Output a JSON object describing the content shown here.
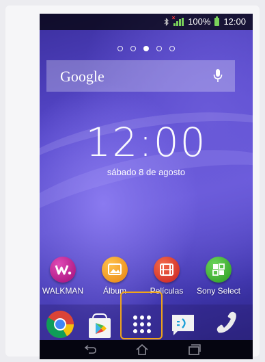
{
  "statusbar": {
    "battery_text": "100%",
    "time": "12:00"
  },
  "home": {
    "page_count": 5,
    "active_page": 3,
    "search": {
      "label": "Google"
    },
    "clock": "12:00",
    "date": "sábado 8 de agosto"
  },
  "apps": [
    {
      "label": "WALKMAN",
      "icon": "walkman-icon",
      "color": "#c0168f"
    },
    {
      "label": "Álbum",
      "icon": "album-icon",
      "color": "#f39a1c"
    },
    {
      "label": "Películas",
      "icon": "movies-icon",
      "color": "#e2362b"
    },
    {
      "label": "Sony Select",
      "icon": "sony-select-icon",
      "color": "#3fb52c"
    }
  ],
  "dock": [
    {
      "icon": "chrome-icon"
    },
    {
      "icon": "play-store-icon"
    },
    {
      "icon": "app-drawer-icon",
      "highlighted": true
    },
    {
      "icon": "messaging-icon"
    },
    {
      "icon": "phone-icon"
    }
  ],
  "navbar": [
    "back-icon",
    "home-icon",
    "recent-apps-icon"
  ],
  "colors": {
    "highlight": "#f0a51a",
    "statusbar_green": "#7bd35b",
    "wallpaper": "#5a4bd0"
  }
}
